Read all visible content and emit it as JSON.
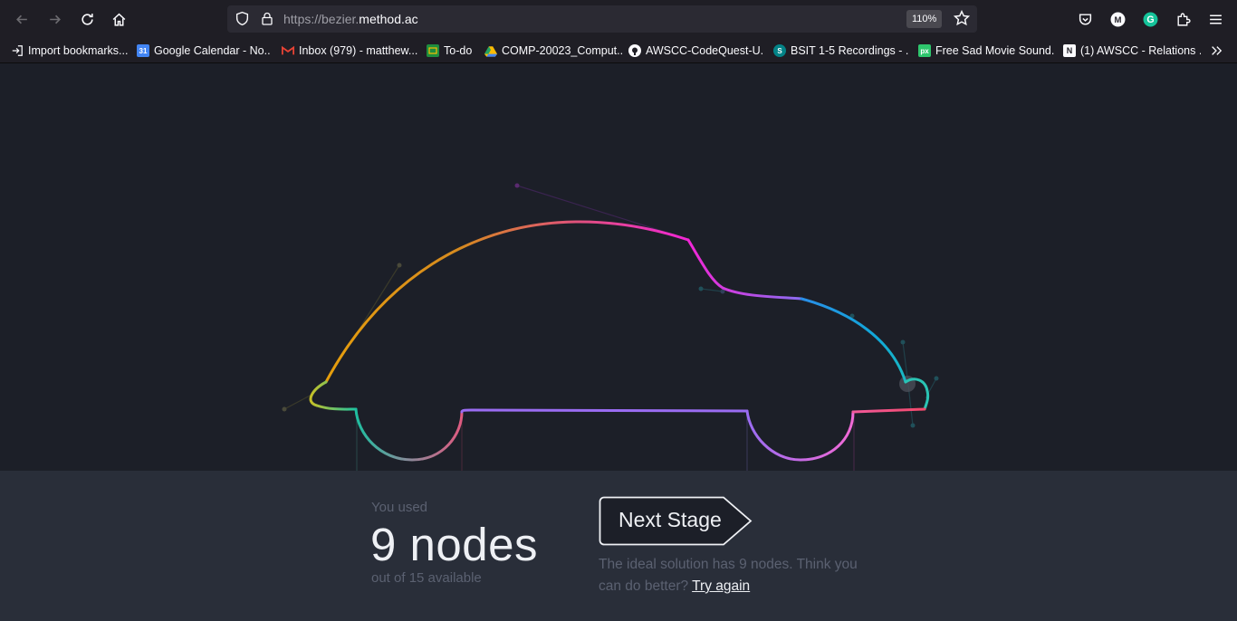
{
  "browser": {
    "url_prefix": "https://bezier.",
    "url_domain": "method.ac",
    "zoom": "110%"
  },
  "bookmarks": [
    {
      "label": "Import bookmarks...",
      "icon": "import-icon",
      "color": "#fbfbfe"
    },
    {
      "label": "Google Calendar - No...",
      "icon": "calendar-icon",
      "color": "#4285f4"
    },
    {
      "label": "Inbox (979) - matthew...",
      "icon": "gmail-icon",
      "color": "#ea4335"
    },
    {
      "label": "To-do",
      "icon": "classroom-icon",
      "color": "#1e8e3e"
    },
    {
      "label": "COMP-20023_Comput...",
      "icon": "drive-icon",
      "color": "#fbbc04"
    },
    {
      "label": "AWSCC-CodeQuest-U...",
      "icon": "github-icon",
      "color": "#fbfbfe"
    },
    {
      "label": "BSIT 1-5 Recordings - ...",
      "icon": "sharepoint-icon",
      "color": "#038387"
    },
    {
      "label": "Free Sad Movie Sound...",
      "icon": "pixabay-icon",
      "color": "#2ec66d"
    },
    {
      "label": "(1) AWSCC - Relations ...",
      "icon": "notion-icon",
      "color": "#fbfbfe"
    }
  ],
  "results": {
    "used_label": "You used",
    "nodes_used": "9 nodes",
    "out_of": "out of 15 available",
    "next_stage": "Next Stage",
    "ideal_text": "The ideal solution has 9 nodes. Think you can do better?",
    "try_again": "Try again"
  },
  "colors": {
    "stage_bg": "#1c1f28",
    "panel_bg": "#292e39",
    "gradient": [
      "#f2b705",
      "#e06a3a",
      "#f226d6",
      "#9a6cf2",
      "#12a6e8",
      "#2ec4b6"
    ]
  }
}
